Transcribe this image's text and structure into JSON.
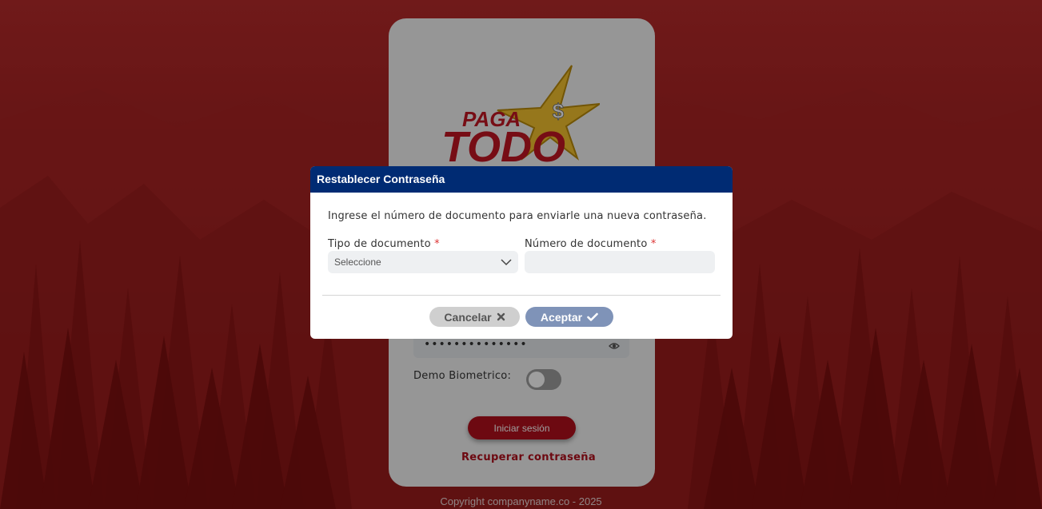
{
  "login": {
    "password_mask": "••••••••••••••",
    "biometric_label": "Demo Biometrico:",
    "login_button": "Iniciar sesión",
    "recover_link": "Recuperar contraseña",
    "copyright": "Copyright companyname.co - 2025"
  },
  "logo": {
    "line1": "PAGA",
    "line2": "TODO",
    "symbol": "$"
  },
  "modal": {
    "title": "Restablecer Contraseña",
    "intro": "Ingrese el número de documento para enviarle una nueva contraseña.",
    "doc_type_label": "Tipo de documento",
    "doc_number_label": "Número de documento",
    "required_mark": "*",
    "doc_type_value": "Seleccione",
    "doc_number_value": "",
    "cancel_label": "Cancelar",
    "accept_label": "Aceptar"
  },
  "icons": {
    "cancel": "close-icon",
    "accept": "check-icon",
    "select": "chevron-down-icon",
    "password": "eye-icon"
  },
  "colors": {
    "brand_red": "#b0101c",
    "header_blue": "#002b73",
    "accept_button": "#7f93b8",
    "cancel_button": "#cfcfcf",
    "star_gold": "#f2c12e"
  }
}
